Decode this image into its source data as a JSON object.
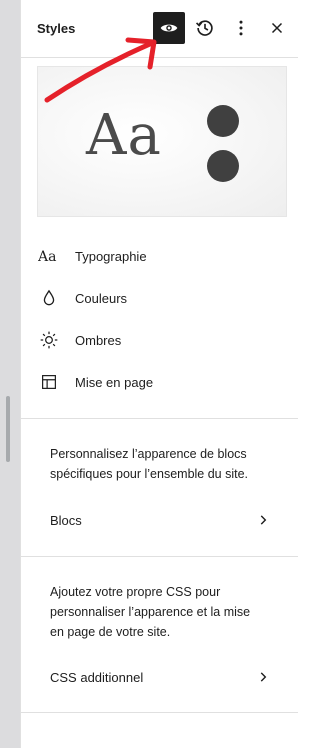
{
  "panel": {
    "title": "Styles",
    "header_buttons": {
      "preview": "eye-icon",
      "revisions": "history-icon",
      "options": "more-vertical-icon",
      "close": "close-icon"
    }
  },
  "preview_card": {
    "sample_text": "Aa"
  },
  "menu": {
    "items": [
      {
        "label": "Typographie",
        "icon": "typography-icon"
      },
      {
        "label": "Couleurs",
        "icon": "droplet-icon"
      },
      {
        "label": "Ombres",
        "icon": "sun-icon"
      },
      {
        "label": "Mise en page",
        "icon": "layout-icon"
      }
    ]
  },
  "blocks_section": {
    "description": "Personnalisez l’apparence de blocs spécifiques pour l’ensemble du site.",
    "link_label": "Blocs"
  },
  "css_section": {
    "description": "Ajoutez votre propre CSS pour personnaliser l’apparence et la mise en page de votre site.",
    "link_label": "CSS additionnel"
  },
  "colors": {
    "annotation_arrow": "#e5212a",
    "active_button": "#1e1e1e"
  }
}
